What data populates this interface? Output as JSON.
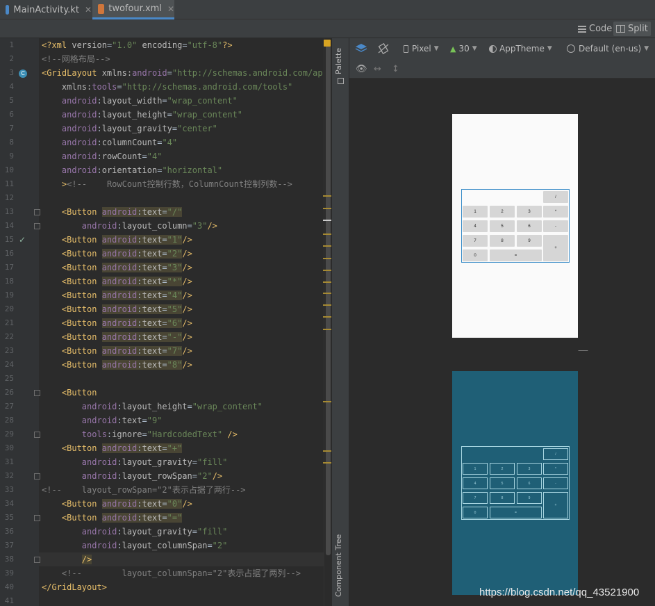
{
  "tabs": [
    {
      "label": "MainActivity.kt",
      "active": false
    },
    {
      "label": "twofour.xml",
      "active": true
    }
  ],
  "viewmodes": {
    "code_label": "Code",
    "split_label": "Split"
  },
  "code_lines": [
    {
      "n": "1",
      "html": "<span class='tag'>&lt;?xml </span><span class='attr'>version</span>=<span class='val'>\"1.0\"</span> <span class='attr'>encoding</span>=<span class='val'>\"utf-8\"</span><span class='tag'>?&gt;</span>"
    },
    {
      "n": "2",
      "html": "<span class='cmt'>&lt;!--网格布局--&gt;</span>"
    },
    {
      "n": "3",
      "html": "<span class='tag'>&lt;GridLayout </span><span class='attr'>xmlns:</span><span class='ns'>android</span>=<span class='val'>\"http://schemas.android.com/apk/res/android\"</span>"
    },
    {
      "n": "4",
      "html": "    <span class='attr'>xmlns:</span><span class='ns'>tools</span>=<span class='val'>\"http://schemas.android.com/tools\"</span>"
    },
    {
      "n": "5",
      "html": "    <span class='ns'>android</span>:<span class='attr'>layout_width</span>=<span class='val'>\"wrap_content\"</span>"
    },
    {
      "n": "6",
      "html": "    <span class='ns'>android</span>:<span class='attr'>layout_height</span>=<span class='val'>\"wrap_content\"</span>"
    },
    {
      "n": "7",
      "html": "    <span class='ns'>android</span>:<span class='attr'>layout_gravity</span>=<span class='val'>\"center\"</span>"
    },
    {
      "n": "8",
      "html": "    <span class='ns'>android</span>:<span class='attr'>columnCount</span>=<span class='val'>\"4\"</span>"
    },
    {
      "n": "9",
      "html": "    <span class='ns'>android</span>:<span class='attr'>rowCount</span>=<span class='val'>\"4\"</span>"
    },
    {
      "n": "10",
      "html": "    <span class='ns'>android</span>:<span class='attr'>orientation</span>=<span class='val'>\"horizontal\"</span>"
    },
    {
      "n": "11",
      "html": "    <span class='tag'>&gt;</span><span class='cmt'>&lt;!--    RowCount控制行数，ColumnCount控制列数--&gt;</span>"
    },
    {
      "n": "12",
      "html": ""
    },
    {
      "n": "13",
      "html": "    <span class='tag'>&lt;Button </span><span class='hl'><span class='ns'>android</span>:<span class='attr'>text</span>=<span class='val'>\"/\"</span></span>"
    },
    {
      "n": "14",
      "html": "        <span class='ns'>android</span>:<span class='attr'>layout_column</span>=<span class='val'>\"3\"</span><span class='tag'>/&gt;</span>"
    },
    {
      "n": "15",
      "html": "    <span class='tag'>&lt;Button </span><span class='hl'><span class='ns'>android</span>:<span class='attr'>text</span>=<span class='val'>\"1\"</span></span><span class='tag'>/&gt;</span>"
    },
    {
      "n": "16",
      "html": "    <span class='tag'>&lt;Button </span><span class='hl'><span class='ns'>android</span>:<span class='attr'>text</span>=<span class='val'>\"2\"</span></span><span class='tag'>/&gt;</span>"
    },
    {
      "n": "17",
      "html": "    <span class='tag'>&lt;Button </span><span class='hl'><span class='ns'>android</span>:<span class='attr'>text</span>=<span class='val'>\"3\"</span></span><span class='tag'>/&gt;</span>"
    },
    {
      "n": "18",
      "html": "    <span class='tag'>&lt;Button </span><span class='hl'><span class='ns'>android</span>:<span class='attr'>text</span>=<span class='val'>\"*\"</span></span><span class='tag'>/&gt;</span>"
    },
    {
      "n": "19",
      "html": "    <span class='tag'>&lt;Button </span><span class='hl'><span class='ns'>android</span>:<span class='attr'>text</span>=<span class='val'>\"4\"</span></span><span class='tag'>/&gt;</span>"
    },
    {
      "n": "20",
      "html": "    <span class='tag'>&lt;Button </span><span class='hl'><span class='ns'>android</span>:<span class='attr'>text</span>=<span class='val'>\"5\"</span></span><span class='tag'>/&gt;</span>"
    },
    {
      "n": "21",
      "html": "    <span class='tag'>&lt;Button </span><span class='hl'><span class='ns'>android</span>:<span class='attr'>text</span>=<span class='val'>\"6\"</span></span><span class='tag'>/&gt;</span>"
    },
    {
      "n": "22",
      "html": "    <span class='tag'>&lt;Button </span><span class='hl'><span class='ns'>android</span>:<span class='attr'>text</span>=<span class='val'>\"-\"</span></span><span class='tag'>/&gt;</span>"
    },
    {
      "n": "23",
      "html": "    <span class='tag'>&lt;Button </span><span class='hl'><span class='ns'>android</span>:<span class='attr'>text</span>=<span class='val'>\"7\"</span></span><span class='tag'>/&gt;</span>"
    },
    {
      "n": "24",
      "html": "    <span class='tag'>&lt;Button </span><span class='hl'><span class='ns'>android</span>:<span class='attr'>text</span>=<span class='val'>\"8\"</span></span><span class='tag'>/&gt;</span>"
    },
    {
      "n": "25",
      "html": ""
    },
    {
      "n": "26",
      "html": "    <span class='tag'>&lt;Button</span>"
    },
    {
      "n": "27",
      "html": "        <span class='ns'>android</span>:<span class='attr'>layout_height</span>=<span class='val'>\"wrap_content\"</span>"
    },
    {
      "n": "28",
      "html": "        <span class='ns'>android</span>:<span class='attr'>text</span>=<span class='val'>\"9\"</span>"
    },
    {
      "n": "29",
      "html": "        <span class='ns'>tools</span>:<span class='attr'>ignore</span>=<span class='val'>\"HardcodedText\"</span> <span class='tag'>/&gt;</span>"
    },
    {
      "n": "30",
      "html": "    <span class='tag'>&lt;Button </span><span class='hl'><span class='ns'>android</span>:<span class='attr'>text</span>=<span class='val'>\"+\"</span></span>"
    },
    {
      "n": "31",
      "html": "        <span class='ns'>android</span>:<span class='attr'>layout_gravity</span>=<span class='val'>\"fill\"</span>"
    },
    {
      "n": "32",
      "html": "        <span class='ns'>android</span>:<span class='attr'>layout_rowSpan</span>=<span class='val'>\"2\"</span><span class='tag'>/&gt;</span>"
    },
    {
      "n": "33",
      "html": "<span class='cmt'>&lt;!--    layout_rowSpan=\"2\"表示占据了两行--&gt;</span>"
    },
    {
      "n": "34",
      "html": "    <span class='tag'>&lt;Button </span><span class='hl'><span class='ns'>android</span>:<span class='attr'>text</span>=<span class='val'>\"0\"</span></span><span class='tag'>/&gt;</span>"
    },
    {
      "n": "35",
      "html": "    <span class='tag'>&lt;Button </span><span class='hl'><span class='ns'>android</span>:<span class='attr'>text</span>=<span class='val'>\"=\"</span></span>"
    },
    {
      "n": "36",
      "html": "        <span class='ns'>android</span>:<span class='attr'>layout_gravity</span>=<span class='val'>\"fill\"</span>"
    },
    {
      "n": "37",
      "html": "        <span class='ns'>android</span>:<span class='attr'>layout_columnSpan</span>=<span class='val'>\"2\"</span>"
    },
    {
      "n": "38",
      "html": "        <span class='hl'><span class='tag'>/&gt;</span></span>"
    },
    {
      "n": "39",
      "html": "    <span class='cmt'>&lt;!--        layout_columnSpan=\"2\"表示占据了两列--&gt;</span>"
    },
    {
      "n": "40",
      "html": "<span class='tag'>&lt;/GridLayout&gt;</span>"
    },
    {
      "n": "41",
      "html": ""
    }
  ],
  "side_panels": {
    "palette": "Palette",
    "component_tree": "Component Tree"
  },
  "design_toolbar": {
    "device": "Pixel",
    "api": "30",
    "theme": "AppTheme",
    "locale": "Default (en-us)"
  },
  "buttons": [
    {
      "label": "/"
    },
    {
      "label": "1"
    },
    {
      "label": "2"
    },
    {
      "label": "3"
    },
    {
      "label": "*"
    },
    {
      "label": "4"
    },
    {
      "label": "5"
    },
    {
      "label": "6"
    },
    {
      "label": "-"
    },
    {
      "label": "7"
    },
    {
      "label": "8"
    },
    {
      "label": "9"
    },
    {
      "label": "+"
    },
    {
      "label": "0"
    },
    {
      "label": "="
    }
  ],
  "watermark": "https://blog.csdn.net/qq_43521900",
  "colors": {
    "accent": "#4a88c7",
    "blueprint": "#1f5f76",
    "highlight": "#494534"
  }
}
